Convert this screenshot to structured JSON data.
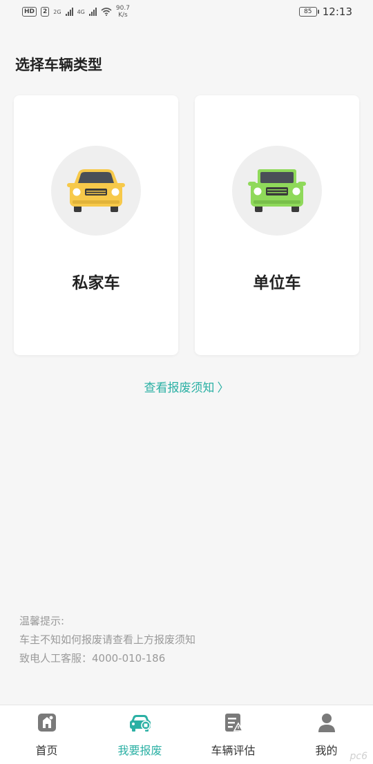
{
  "status_bar": {
    "hd_badge": "HD",
    "sim_label": "2",
    "net1": "2G",
    "net2": "4G",
    "speed_value": "90.7",
    "speed_unit": "K/s",
    "battery": "85",
    "time": "12:13"
  },
  "page": {
    "title": "选择车辆类型"
  },
  "cards": [
    {
      "label": "私家车",
      "car_color": "#f7c94a",
      "icon": "yellow-car-icon"
    },
    {
      "label": "单位车",
      "car_color": "#8fd95a",
      "icon": "green-car-icon"
    }
  ],
  "notice_link": {
    "text": "查看报废须知",
    "chevron": "〉"
  },
  "tips": {
    "line1": "温馨提示:",
    "line2": "车主不知如何报废请查看上方报废须知",
    "line3": "致电人工客服：4000-010-186"
  },
  "tabbar": {
    "items": [
      {
        "label": "首页",
        "icon": "home-icon"
      },
      {
        "label": "我要报废",
        "icon": "scrap-car-icon"
      },
      {
        "label": "车辆评估",
        "icon": "evaluate-icon"
      },
      {
        "label": "我的",
        "icon": "profile-icon"
      }
    ]
  },
  "colors": {
    "accent": "#2bb0a4",
    "tip_text": "#9a9a9a"
  },
  "watermark": "pc6"
}
